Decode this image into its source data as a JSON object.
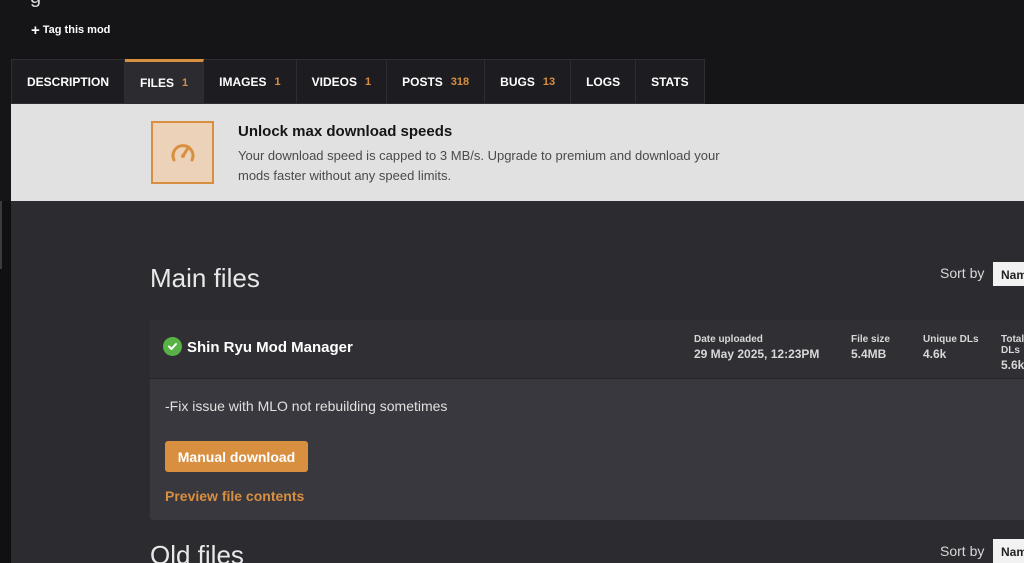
{
  "header": {
    "title_fragment": "g",
    "tag_link": "Tag this mod"
  },
  "tabs": [
    {
      "label": "DESCRIPTION",
      "count": ""
    },
    {
      "label": "FILES",
      "count": "1"
    },
    {
      "label": "IMAGES",
      "count": "1"
    },
    {
      "label": "VIDEOS",
      "count": "1"
    },
    {
      "label": "POSTS",
      "count": "318"
    },
    {
      "label": "BUGS",
      "count": "13"
    },
    {
      "label": "LOGS",
      "count": ""
    },
    {
      "label": "STATS",
      "count": ""
    }
  ],
  "active_tab": "FILES",
  "banner": {
    "icon": "speedometer-icon",
    "title": "Unlock max download speeds",
    "text": "Your download speed is capped to 3 MB/s. Upgrade to premium and download your mods faster without any speed limits."
  },
  "main_files": {
    "title": "Main files",
    "sort_label": "Sort by",
    "sort_value": "Name"
  },
  "file": {
    "name": "Shin Ryu Mod Manager",
    "status_icon": "check-circle-icon",
    "date_label": "Date uploaded",
    "date_value": "29 May 2025, 12:23PM",
    "size_label": "File size",
    "size_value": "5.4MB",
    "unique_label": "Unique DLs",
    "unique_value": "4.6k",
    "total_label": "Total DLs",
    "total_value": "5.6k",
    "description": "-Fix issue with MLO not rebuilding sometimes",
    "download_button": "Manual download",
    "preview_link": "Preview file contents"
  },
  "old_files": {
    "title": "Old files",
    "sort_label": "Sort by",
    "sort_value": "Name"
  },
  "colors": {
    "accent": "#d98f40",
    "success": "#58b245",
    "background": "#2b2b30"
  }
}
